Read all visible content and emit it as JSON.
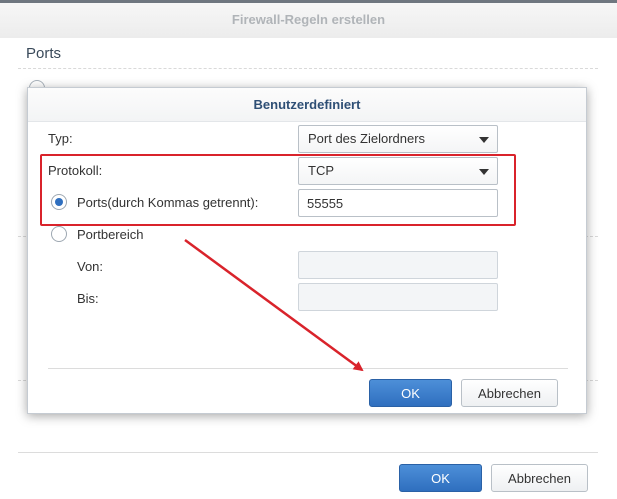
{
  "outer_window": {
    "title": "Firewall-Regeln erstellen",
    "section_title": "Ports",
    "ok_label": "OK",
    "cancel_label": "Abbrechen"
  },
  "dialog": {
    "title": "Benutzerdefiniert",
    "type_label": "Typ:",
    "type_value": "Port des Zielordners",
    "protocol_label": "Protokoll:",
    "protocol_value": "TCP",
    "ports_option_label": "Ports(durch Kommas getrennt):",
    "ports_value": "55555",
    "ports_option_checked": true,
    "range_option_label": "Portbereich",
    "range_option_checked": false,
    "from_label": "Von:",
    "from_value": "",
    "to_label": "Bis:",
    "to_value": "",
    "ok_label": "OK",
    "cancel_label": "Abbrechen"
  },
  "colors": {
    "primary_button": "#2f6fbf",
    "dialog_title": "#2e4f75",
    "annotation_red": "#d9232b"
  }
}
